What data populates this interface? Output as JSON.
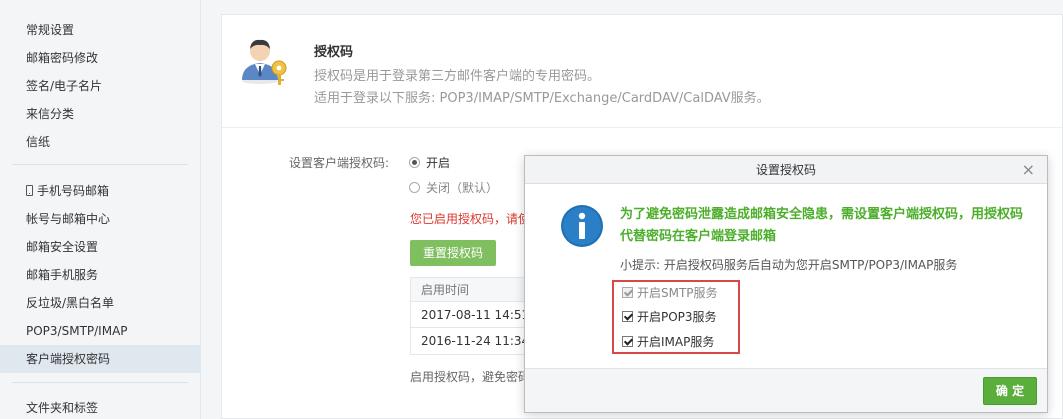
{
  "sidebar": {
    "items": [
      {
        "label": "常规设置"
      },
      {
        "label": "邮箱密码修改"
      },
      {
        "label": "签名/电子名片"
      },
      {
        "label": "来信分类"
      },
      {
        "label": "信纸"
      },
      {
        "label": "手机号码邮箱",
        "icon": "phone-icon"
      },
      {
        "label": "帐号与邮箱中心"
      },
      {
        "label": "邮箱安全设置"
      },
      {
        "label": "邮箱手机服务"
      },
      {
        "label": "反垃圾/黑白名单"
      },
      {
        "label": "POP3/SMTP/IMAP"
      },
      {
        "label": "客户端授权密码",
        "active": true
      },
      {
        "label": "文件夹和标签"
      }
    ]
  },
  "main": {
    "title": "授权码",
    "desc_line1": "授权码是用于登录第三方邮件客户端的专用密码。",
    "desc_line2": "适用于登录以下服务: POP3/IMAP/SMTP/Exchange/CardDAV/CalDAV服务。",
    "setting_label": "设置客户端授权码:",
    "radio_on": "开启",
    "radio_off": "关闭（默认）",
    "warning": "您已启用授权码，请使",
    "reset_button": "重置授权码",
    "table_header": "启用时间",
    "table_rows": [
      "2017-08-11 14:51:",
      "2016-11-24 11:34:"
    ],
    "footer_note": "启用授权码，避免密码"
  },
  "dialog": {
    "title": "设置授权码",
    "message": "为了避免密码泄露造成邮箱安全隐患，需设置客户端授权码，用授权码代替密码在客户端登录邮箱",
    "tip": "小提示: 开启授权码服务后自动为您开启SMTP/POP3/IMAP服务",
    "options": [
      {
        "label": "开启SMTP服务",
        "checked": true,
        "disabled": true
      },
      {
        "label": "开启POP3服务",
        "checked": true,
        "disabled": false
      },
      {
        "label": "开启IMAP服务",
        "checked": true,
        "disabled": false
      }
    ],
    "ok_button": "确 定",
    "close_glyph": "×"
  },
  "colors": {
    "accent_green": "#5aae3b",
    "warning_red": "#d9382e",
    "highlight_box": "#d8474a",
    "info_blue": "#1f6fb5"
  }
}
